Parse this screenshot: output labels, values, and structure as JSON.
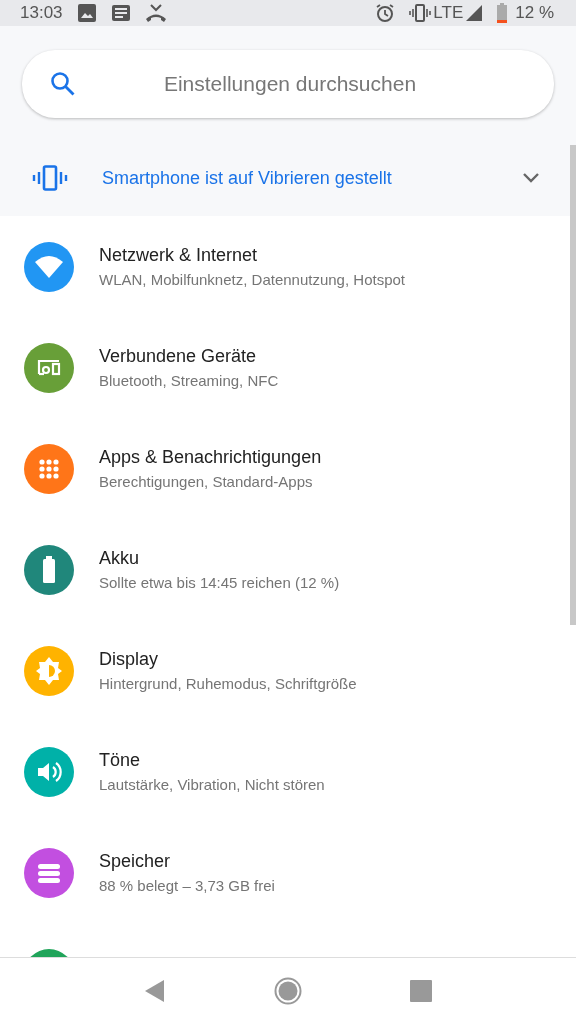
{
  "status_bar": {
    "time": "13:03",
    "network": "LTE",
    "battery": "12 %"
  },
  "search": {
    "placeholder": "Einstellungen durchsuchen"
  },
  "condition": {
    "text": "Smartphone ist auf Vibrieren gestellt",
    "expanded": false
  },
  "items": [
    {
      "kind": "wifi",
      "color": "#2196f3",
      "title": "Netzwerk & Internet",
      "summary": "WLAN, Mobilfunknetz, Datennutzung, Hotspot"
    },
    {
      "kind": "devices",
      "color": "#689f38",
      "title": "Verbundene Geräte",
      "summary": "Bluetooth, Streaming, NFC"
    },
    {
      "kind": "apps",
      "color": "#ff7518",
      "title": "Apps & Benachrichtigungen",
      "summary": "Berechtigungen, Standard-Apps"
    },
    {
      "kind": "battery",
      "color": "#20877b",
      "title": "Akku",
      "summary": "Sollte etwa bis 14:45 reichen (12 %)"
    },
    {
      "kind": "display",
      "color": "#ffb300",
      "title": "Display",
      "summary": "Hintergrund, Ruhemodus, Schriftgröße"
    },
    {
      "kind": "sound",
      "color": "#00b1a8",
      "title": "Töne",
      "summary": "Lautstärke, Vibration, Nicht stören"
    },
    {
      "kind": "storage",
      "color": "#c24fe0",
      "title": "Speicher",
      "summary": "88 % belegt – 3,73 GB frei"
    },
    {
      "kind": "partial",
      "color": "#20a45a"
    }
  ]
}
